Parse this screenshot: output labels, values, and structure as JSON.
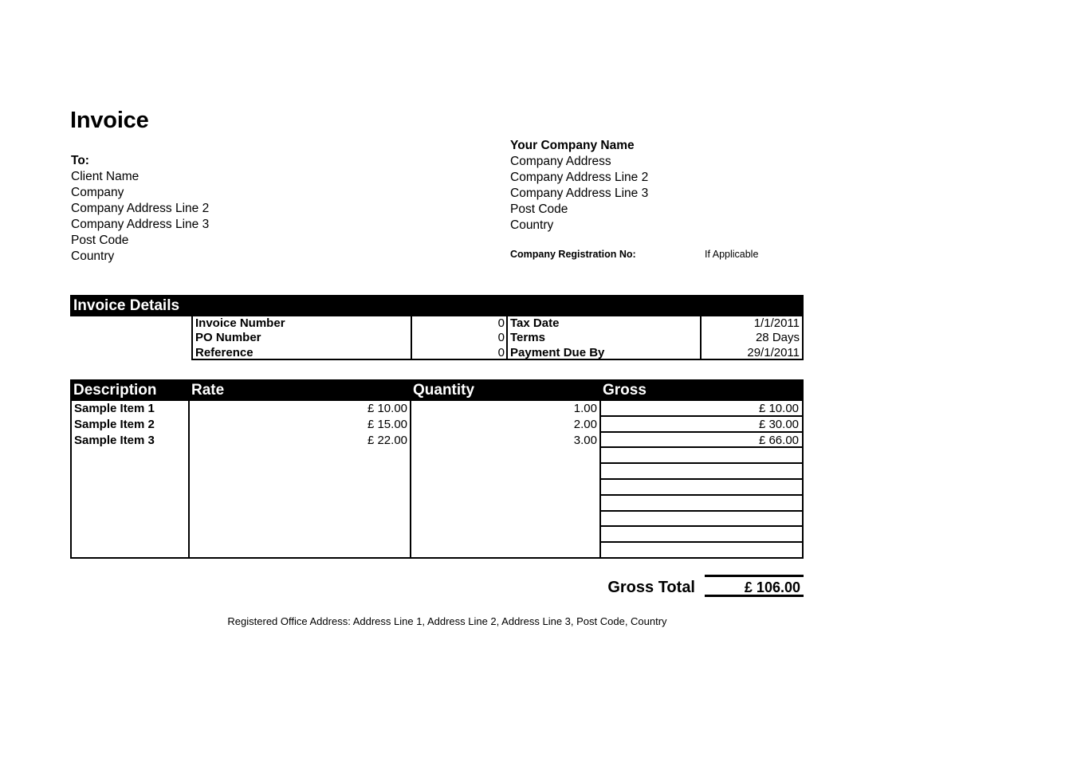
{
  "document": {
    "title": "Invoice"
  },
  "bill_to": {
    "label": "To:",
    "lines": [
      "Client Name",
      "Company",
      "Company Address Line 2",
      "Company Address Line 3",
      "Post Code",
      "Country"
    ]
  },
  "company": {
    "name": "Your Company Name",
    "lines": [
      "Company Address",
      "Company Address Line 2",
      "Company Address Line 3",
      "Post Code",
      "Country"
    ],
    "registration_label": "Company Registration No:",
    "registration_value": "If Applicable"
  },
  "invoice_details": {
    "section_title": "Invoice Details",
    "rows": [
      {
        "label": "Invoice Number",
        "value": "0",
        "label2": "Tax Date",
        "value2": "1/1/2011"
      },
      {
        "label": "PO Number",
        "value": "0",
        "label2": "Terms",
        "value2": "28 Days"
      },
      {
        "label": "Reference",
        "value": "0",
        "label2": "Payment Due By",
        "value2": "29/1/2011"
      }
    ]
  },
  "line_items": {
    "columns": {
      "description": "Description",
      "rate": "Rate",
      "quantity": "Quantity",
      "gross": "Gross"
    },
    "rows": [
      {
        "description": "Sample Item 1",
        "rate": "£ 10.00",
        "quantity": "1.00",
        "gross": "£ 10.00"
      },
      {
        "description": "Sample Item 2",
        "rate": "£ 15.00",
        "quantity": "2.00",
        "gross": "£ 30.00"
      },
      {
        "description": "Sample Item 3",
        "rate": "£ 22.00",
        "quantity": "3.00",
        "gross": "£ 66.00"
      },
      {
        "description": "",
        "rate": "",
        "quantity": "",
        "gross": ""
      },
      {
        "description": "",
        "rate": "",
        "quantity": "",
        "gross": ""
      },
      {
        "description": "",
        "rate": "",
        "quantity": "",
        "gross": ""
      },
      {
        "description": "",
        "rate": "",
        "quantity": "",
        "gross": ""
      },
      {
        "description": "",
        "rate": "",
        "quantity": "",
        "gross": ""
      },
      {
        "description": "",
        "rate": "",
        "quantity": "",
        "gross": ""
      },
      {
        "description": "",
        "rate": "",
        "quantity": "",
        "gross": ""
      }
    ]
  },
  "totals": {
    "label": "Gross Total",
    "amount": "£ 106.00"
  },
  "footer": {
    "text": "Registered Office Address: Address Line 1, Address Line 2, Address Line 3, Post Code, Country"
  },
  "colors": {
    "header_bg": "#000000",
    "header_text": "#ffffff",
    "page_bg": "#ffffff",
    "body_text": "#000000"
  }
}
